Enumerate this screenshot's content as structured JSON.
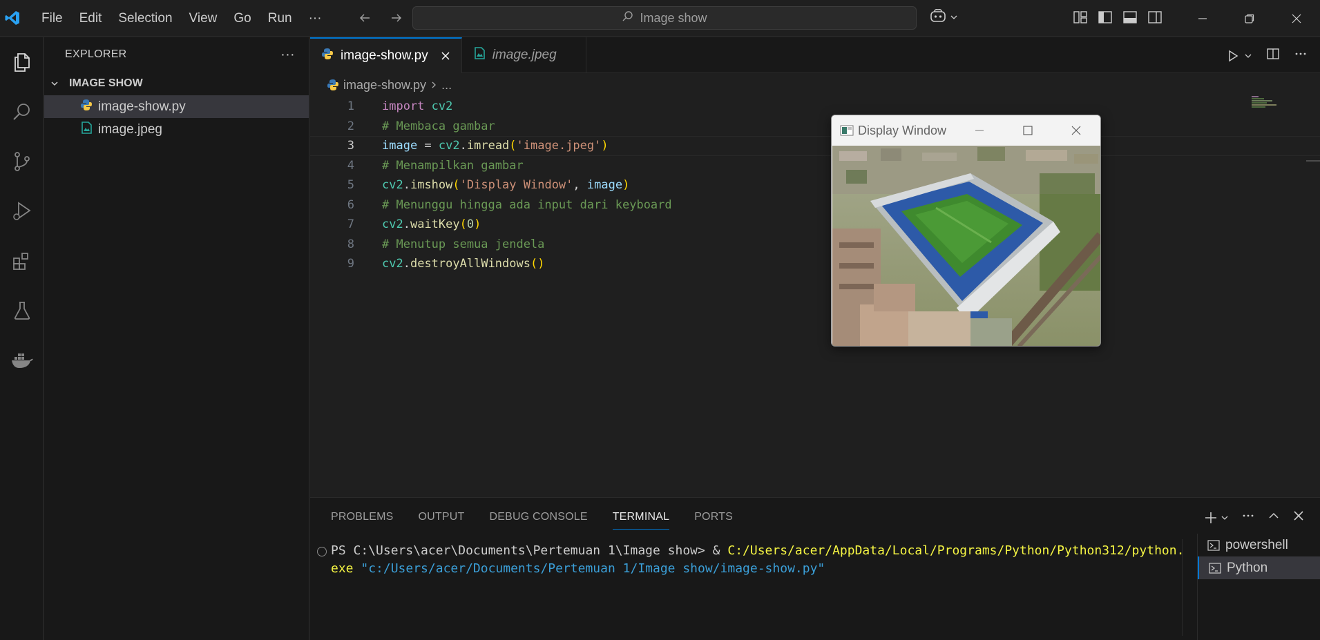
{
  "titlebar": {
    "menu": [
      "File",
      "Edit",
      "Selection",
      "View",
      "Go",
      "Run",
      "···"
    ],
    "search_text": "Image show"
  },
  "activity_icons": [
    "files-icon",
    "search-icon",
    "source-control-icon",
    "run-debug-icon",
    "extensions-icon",
    "testing-icon",
    "docker-icon"
  ],
  "sidebar": {
    "title": "EXPLORER",
    "more": "···",
    "folder": "IMAGE SHOW",
    "files": [
      {
        "name": "image-show.py",
        "icon": "python-file-icon",
        "active": true
      },
      {
        "name": "image.jpeg",
        "icon": "image-file-icon",
        "active": false
      }
    ]
  },
  "editor": {
    "tabs": [
      {
        "label": "image-show.py",
        "active": true
      },
      {
        "label": "image.jpeg",
        "active": false
      }
    ],
    "breadcrumb": {
      "file": "image-show.py",
      "rest": "..."
    },
    "current_line": 3,
    "lines": [
      {
        "n": "1"
      },
      {
        "n": "2"
      },
      {
        "n": "3"
      },
      {
        "n": "4"
      },
      {
        "n": "5"
      },
      {
        "n": "6"
      },
      {
        "n": "7"
      },
      {
        "n": "8"
      },
      {
        "n": "9"
      }
    ],
    "tokens": {
      "l1_kw": "import",
      "l1_mod": "cv2",
      "l2_cm": "# Membaca gambar",
      "l3_var": "image",
      "l3_op": " = ",
      "l3_mod": "cv2",
      "l3_dot": ".",
      "l3_fn": "imread",
      "l3_open": "(",
      "l3_str": "'image.jpeg'",
      "l3_close": ")",
      "l4_cm": "# Menampilkan gambar",
      "l5_mod": "cv2",
      "l5_dot": ".",
      "l5_fn": "imshow",
      "l5_open": "(",
      "l5_str": "'Display Window'",
      "l5_comma": ", ",
      "l5_var": "image",
      "l5_close": ")",
      "l6_cm": "# Menunggu hingga ada input dari keyboard",
      "l7_mod": "cv2",
      "l7_dot": ".",
      "l7_fn": "waitKey",
      "l7_open": "(",
      "l7_num": "0",
      "l7_close": ")",
      "l8_cm": "# Menutup semua jendela",
      "l9_mod": "cv2",
      "l9_dot": ".",
      "l9_fn": "destroyAllWindows",
      "l9_paren": "()"
    }
  },
  "cv_window": {
    "title": "Display Window"
  },
  "panel": {
    "tabs": [
      "PROBLEMS",
      "OUTPUT",
      "DEBUG CONSOLE",
      "TERMINAL",
      "PORTS"
    ],
    "active_tab": "TERMINAL",
    "terminal": {
      "prompt": "PS C:\\Users\\acer\\Documents\\Pertemuan 1\\Image show> & ",
      "exe": "C:/Users/acer/AppData/Local/Programs/Python/Python312/python.exe",
      "space": " ",
      "arg": "\"c:/Users/acer/Documents/Pertemuan 1/Image show/image-show.py\""
    },
    "terminals": [
      {
        "name": "powershell",
        "active": false
      },
      {
        "name": "Python",
        "active": true
      }
    ]
  },
  "colors": {
    "accent": "#0078d4",
    "background": "#1f1f1f",
    "sidebar": "#181818"
  }
}
